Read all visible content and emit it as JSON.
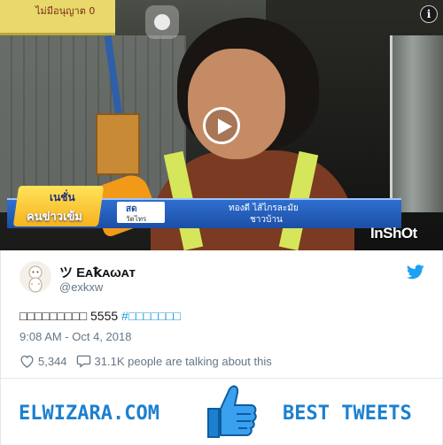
{
  "video": {
    "background_sign": "ไม่มีอนุญาต 0",
    "news_logo_top": "เนชั่น",
    "news_logo_main": "คนข่าวเข้ม",
    "live_label": "สด",
    "live_place": "วัดไทร",
    "reporter_name": "ทองดี ไส้ไกรละมัย",
    "reporter_role": "ชาวบ้าน",
    "watermark": "InShOt",
    "info_icon": "i",
    "icons": [
      "info-icon",
      "record-icon",
      "play-icon"
    ]
  },
  "tweet": {
    "display_name": "ツ Eᴀꝁᴀωᴀт",
    "screen_name": "@exkxw",
    "text_prefix": "□□□□□□□□□ 5555",
    "hashtag": "#□□□□□□□",
    "timestamp": "9:08 AM - Oct 4, 2018",
    "likes": "5,344",
    "conversation": "31.1K people are talking about this",
    "colors": {
      "link": "#1b95e0",
      "meta": "#657786",
      "text": "#14171a",
      "brand": "#1da1f2"
    }
  },
  "banner": {
    "left_text": "ELWIZARA.COM",
    "right_text": "BEST TWEETS",
    "color": "#1c80d0"
  }
}
